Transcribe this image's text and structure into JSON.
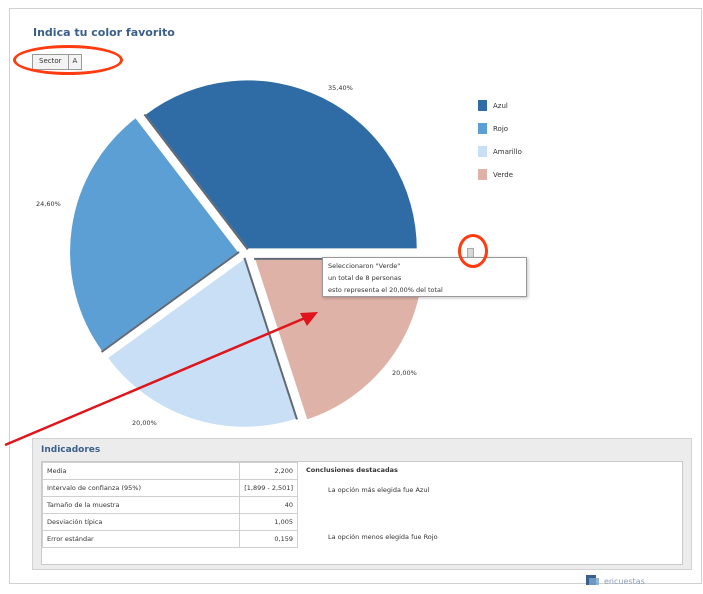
{
  "chart": {
    "title": "Indica tu color favorito"
  },
  "control": {
    "selected": "Sector",
    "toggle": "A"
  },
  "chart_data": {
    "type": "pie",
    "categories": [
      "Azul",
      "Rojo",
      "Amarillo",
      "Verde"
    ],
    "values": [
      35.4,
      24.6,
      20.0,
      20.0
    ],
    "labels": [
      "35,40%",
      "24,60%",
      "20,00%",
      "20,00%"
    ],
    "colors": [
      "#2f6ba5",
      "#5b9fd4",
      "#c8dff5",
      "#dfb2a8"
    ],
    "legend_position": "right"
  },
  "legend": [
    {
      "label": "Azul",
      "color": "#2f6ba5"
    },
    {
      "label": "Rojo",
      "color": "#5b9fd4"
    },
    {
      "label": "Amarillo",
      "color": "#c8dff5"
    },
    {
      "label": "Verde",
      "color": "#dfb2a8"
    }
  ],
  "tooltip": {
    "line1": "Seleccionaron \"Verde\"",
    "line2": "un total de 8 personas",
    "line3": "esto representa el 20,00% del total"
  },
  "stats": {
    "header": "Indicadores",
    "rows": [
      {
        "label": "Media",
        "value": "2,200"
      },
      {
        "label": "Intervalo de confianza (95%)",
        "value": "[1,899 - 2,501]"
      },
      {
        "label": "Tamaño de la muestra",
        "value": "40"
      },
      {
        "label": "Desviación típica",
        "value": "1,005"
      },
      {
        "label": "Error estándar",
        "value": "0,159"
      }
    ]
  },
  "conclusions": {
    "title": "Conclusiones destacadas",
    "line1": "La opción más elegida fue Azul",
    "line2": "La opción menos elegida fue Rojo"
  },
  "logo": {
    "text": "encuestas"
  }
}
